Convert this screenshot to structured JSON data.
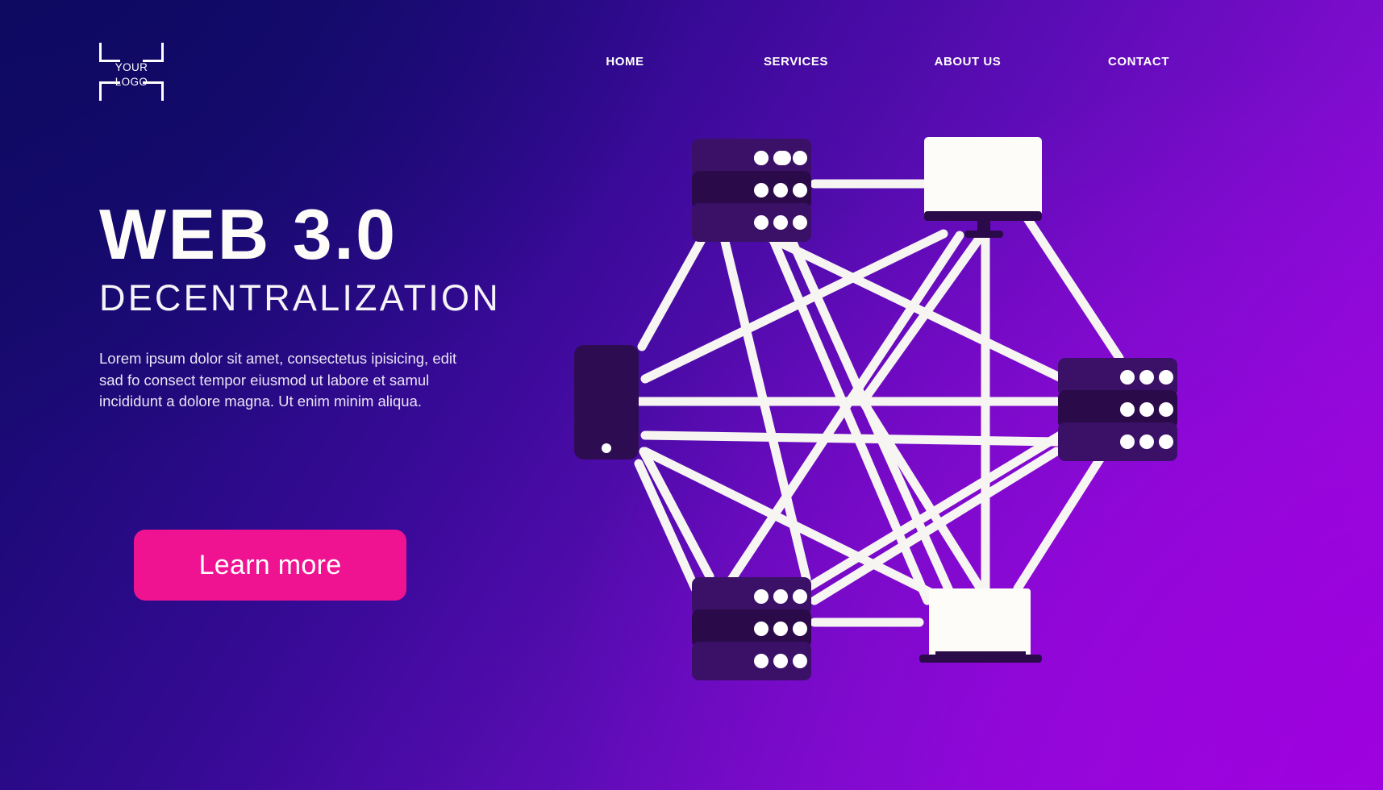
{
  "brand": {
    "logo_line1": "YOUR",
    "logo_line2": "LOGO",
    "logo_icon": "crop-brackets-icon"
  },
  "nav": {
    "items": [
      {
        "label": "HOME",
        "name": "nav-item-home"
      },
      {
        "label": "SERVICES",
        "name": "nav-item-services"
      },
      {
        "label": "ABOUT US",
        "name": "nav-item-about-us"
      },
      {
        "label": "CONTACT",
        "name": "nav-item-contact"
      }
    ]
  },
  "hero": {
    "title": "WEB 3.0",
    "subtitle": "DECENTRALIZATION",
    "paragraph": "Lorem ipsum dolor sit amet, consectetus ipisicing, edit sad fo consect tempor eiusmod ut labore et samul incididunt a dolore magna. Ut enim minim aliqua.",
    "cta_label": "Learn more"
  },
  "illustration": {
    "name": "decentralized-network-diagram",
    "nodes": [
      {
        "name": "server-node-top-left",
        "type": "server"
      },
      {
        "name": "monitor-node-top",
        "type": "monitor"
      },
      {
        "name": "server-node-right",
        "type": "server"
      },
      {
        "name": "laptop-node-bottom",
        "type": "laptop"
      },
      {
        "name": "server-node-bottom-left",
        "type": "server"
      },
      {
        "name": "phone-node-left",
        "type": "phone"
      }
    ],
    "link_count": 15
  },
  "colors": {
    "accent_pink": "#ef1391",
    "bg_dark_navy": "#130a63",
    "bg_purple": "#9a0ae0",
    "node_dark": "#2c0b52",
    "node_darker": "#230640",
    "line_white": "#f7f5f2",
    "text_white": "#ffffff"
  }
}
